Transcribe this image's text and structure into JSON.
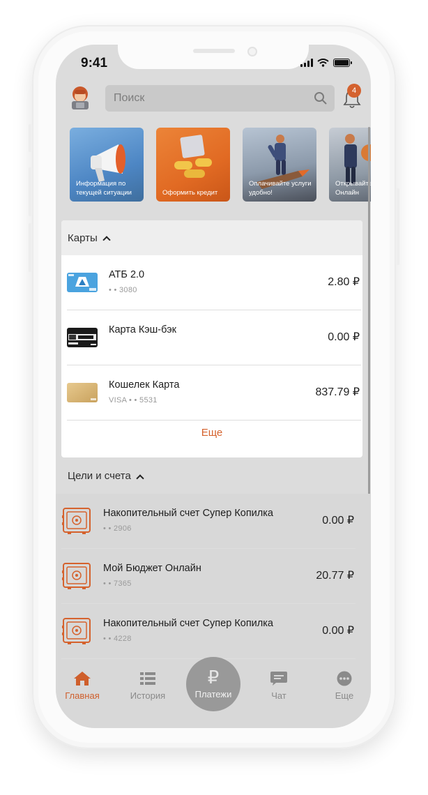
{
  "status_bar": {
    "time": "9:41"
  },
  "header": {
    "search_placeholder": "Поиск",
    "notifications_count": "4"
  },
  "stories": [
    {
      "label": "Информация по текущей ситуации"
    },
    {
      "label": "Оформить кредит"
    },
    {
      "label": "Оплачивайте услуги удобно!"
    },
    {
      "label": "Открывайте вклад Онлайн"
    }
  ],
  "cards_section": {
    "title": "Карты",
    "items": [
      {
        "title": "АТБ 2.0",
        "sub": "• • 3080",
        "amount": "2.80 ₽"
      },
      {
        "title": "Карта Кэш-бэк",
        "sub": "",
        "amount": "0.00 ₽"
      },
      {
        "title": "Кошелек Карта",
        "sub": "VISA • • 5531",
        "amount": "837.79 ₽"
      }
    ],
    "more_label": "Еще"
  },
  "goals_section": {
    "title": "Цели и счета",
    "items": [
      {
        "title": "Накопительный счет Супер Копилка",
        "sub": "• • 2906",
        "amount": "0.00 ₽"
      },
      {
        "title": "Мой Бюджет Онлайн",
        "sub": "• • 7365",
        "amount": "20.77 ₽"
      },
      {
        "title": "Накопительный счет Супер Копилка",
        "sub": "• • 4228",
        "amount": "0.00 ₽"
      }
    ]
  },
  "tabbar": {
    "home": "Главная",
    "history": "История",
    "payments": "Платежи",
    "payments_symbol": "₽",
    "chat": "Чат",
    "more": "Еще"
  },
  "colors": {
    "accent": "#cf5f2c",
    "screen_bg": "#dcdcdc",
    "card_bg": "#ffffff"
  },
  "icons": [
    "search-icon",
    "bell-icon",
    "home-icon",
    "list-icon",
    "ruble-icon",
    "chat-icon",
    "more-dots-icon",
    "safe-icon"
  ]
}
